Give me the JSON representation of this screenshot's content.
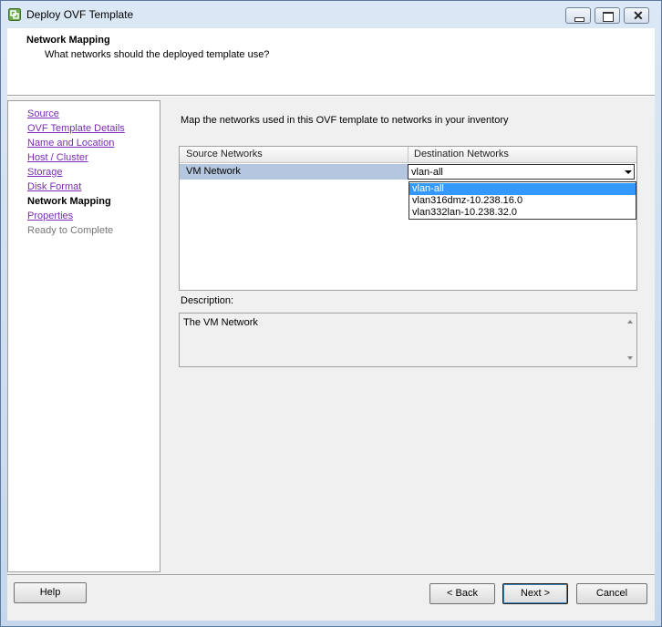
{
  "window": {
    "title": "Deploy OVF Template",
    "minimize_glyph": "",
    "maximize_glyph": "",
    "close_glyph": "✕"
  },
  "header": {
    "title": "Network Mapping",
    "subtitle": "What networks should the deployed template use?"
  },
  "nav": {
    "items": [
      {
        "label": "Source",
        "state": "link"
      },
      {
        "label": "OVF Template Details",
        "state": "link"
      },
      {
        "label": "Name and Location",
        "state": "link"
      },
      {
        "label": "Host / Cluster",
        "state": "link"
      },
      {
        "label": "Storage",
        "state": "link"
      },
      {
        "label": "Disk Format",
        "state": "link"
      },
      {
        "label": "Network Mapping",
        "state": "current"
      },
      {
        "label": "Properties",
        "state": "link"
      },
      {
        "label": "Ready to Complete",
        "state": "disabled"
      }
    ]
  },
  "main": {
    "instruction": "Map the networks used in this OVF template to networks in your inventory",
    "table": {
      "columns": [
        "Source Networks",
        "Destination Networks"
      ],
      "rows": [
        {
          "source": "VM Network",
          "destination": "vlan-all"
        }
      ]
    },
    "dropdown": {
      "options": [
        "vlan-all",
        "vlan316dmz-10.238.16.0",
        "vlan332lan-10.238.32.0"
      ],
      "selected_index": 0
    },
    "description_label": "Description:",
    "description_text": "The VM Network"
  },
  "footer": {
    "help": "Help",
    "back": "< Back",
    "next": "Next >",
    "cancel": "Cancel"
  },
  "colors": {
    "selection": "#3399ff",
    "row_highlight": "#b5c7e0",
    "link": "#7b2bb5"
  }
}
